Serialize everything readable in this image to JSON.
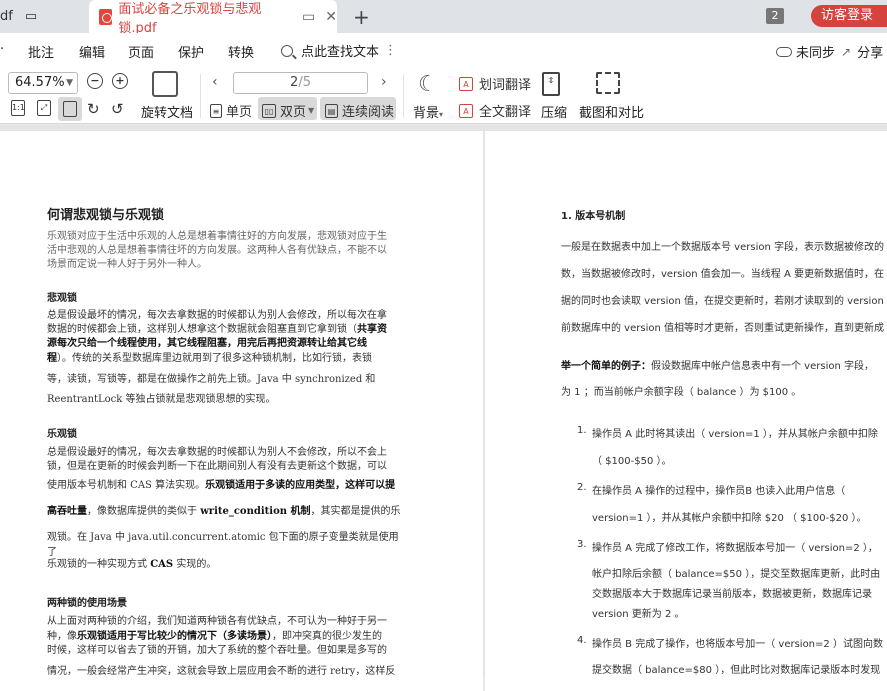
{
  "tabs": {
    "prev_title": "df",
    "current_title": "面试必备之乐观锁与悲观锁.pdf",
    "window_count": "2",
    "visitor_login": "访客登录"
  },
  "menu": {
    "items": [
      "批注",
      "编辑",
      "页面",
      "保护",
      "转换"
    ],
    "search_label": "点此查找文本",
    "sync_label": "未同步",
    "share_label": "分享"
  },
  "toolbar": {
    "zoom": "64.57%",
    "rotate_doc": "旋转文档",
    "page_current": "2",
    "page_total": "/5",
    "single_page": "单页",
    "double_page": "双页",
    "continuous": "连续阅读",
    "background": "背景",
    "word_translate": "划词翻译",
    "full_translate": "全文翻译",
    "compress": "压缩",
    "screenshot_compare": "截图和对比"
  },
  "left_page": {
    "title": "何谓悲观锁与乐观锁",
    "intro_1": "乐观锁对应于生活中乐观的人总是想着事情往好的方向发展，悲观锁对应于生",
    "intro_2": "活中悲观的人总是想着事情往坏的方向发展。这两种人各有优缺点，不能不以",
    "intro_3": "场景而定说一种人好于另外一种人。",
    "pessimistic_heading": "悲观锁",
    "pess_1": "总是假设最坏的情况，每次去拿数据的时候都认为别人会修改，所以每次在拿",
    "pess_2a": "数据的时候都会上锁，这样别人想拿这个数据就会阻塞直到它拿到锁（",
    "pess_2b": "共享资",
    "pess_3": "源每次只给一个线程使用，其它线程阻塞，用完后再把资源转让给其它线",
    "pess_4a": "程",
    "pess_4b": "）。传统的关系型数据库里边就用到了很多这种锁机制，比如行锁，表锁",
    "pess_5": "等，读锁，写锁等，都是在做操作之前先上锁。Java 中 synchronized 和",
    "pess_6": "ReentrantLock 等独占锁就是悲观锁思想的实现。",
    "optimistic_heading": "乐观锁",
    "opt_1": "总是假设最好的情况，每次去拿数据的时候都认为别人不会修改，所以不会上",
    "opt_2": "锁，但是在更新的时候会判断一下在此期间别人有没有去更新这个数据，可以",
    "opt_3a": "使用版本号机制和 CAS 算法实现。",
    "opt_3b": "乐观锁适用于多读的应用类型，这样可以提",
    "opt_4a": "高吞吐量",
    "opt_4b": "，像数据库提供的类似于 ",
    "opt_4c": "write_condition 机制",
    "opt_4d": "，其实都是提供的乐",
    "opt_5": "观锁。在 Java 中 java.util.concurrent.atomic 包下面的原子变量类就是使用了",
    "opt_6a": "乐观锁的一种实现方式 ",
    "opt_6b": "CAS",
    "opt_6c": " 实现的。",
    "scenario_heading": "两种锁的使用场景",
    "sc_1": "从上面对两种锁的介绍，我们知道两种锁各有优缺点，不可认为一种好于另一",
    "sc_2a": "种，像",
    "sc_2b": "乐观锁适用于写比较少的情况下（多读场景）",
    "sc_2c": "，即冲突真的很少发生的",
    "sc_3": "时候，这样可以省去了锁的开销，加大了系统的整个吞吐量。但如果是多写的",
    "sc_4": "情况，一般会经常产生冲突，这就会导致上层应用会不断的进行 retry，这样反"
  },
  "right_page": {
    "heading": "1. 版本号机制",
    "p1": "一般是在数据表中加上一个数据版本号 version 字段，表示数据被修改的",
    "p2": "数，当数据被修改时，version 值会加一。当线程 A 要更新数据值时，在",
    "p3": "据的同时也会读取 version 值，在提交更新时，若刚才读取到的 version 值",
    "p4": "前数据库中的 version 值相等时才更新，否则重试更新操作，直到更新成",
    "ex_bold": "举一个简单的例子：",
    "ex_1": "假设数据库中帐户信息表中有一个 version 字段，",
    "ex_2": "为 1 ；而当前帐户余额字段（ balance ）为 $100 。",
    "item1_num": "1.",
    "item1_a": "操作员 A 此时将其读出（ version=1 ），并从其帐户余额中扣除",
    "item1_b": "（ $100-$50 ）。",
    "item2_num": "2.",
    "item2_a": "在操作员 A 操作的过程中，操作员B 也读入此用户信息（",
    "item2_b": "version=1 ），并从其帐户余额中扣除 $20 （ $100-$20 ）。",
    "item3_num": "3.",
    "item3_a": "操作员 A 完成了修改工作，将数据版本号加一（ version=2 ），",
    "item3_b": "帐户扣除后余额（ balance=$50 ），提交至数据库更新，此时由",
    "item3_c": "交数据版本大于数据库记录当前版本，数据被更新，数据库记录",
    "item3_d": "version 更新为 2 。",
    "item4_num": "4.",
    "item4_a": "操作员 B 完成了操作，也将版本号加一（ version=2 ）试图向数",
    "item4_b": "提交数据（ balance=$80 ），但此时比对数据库记录版本时发现"
  }
}
